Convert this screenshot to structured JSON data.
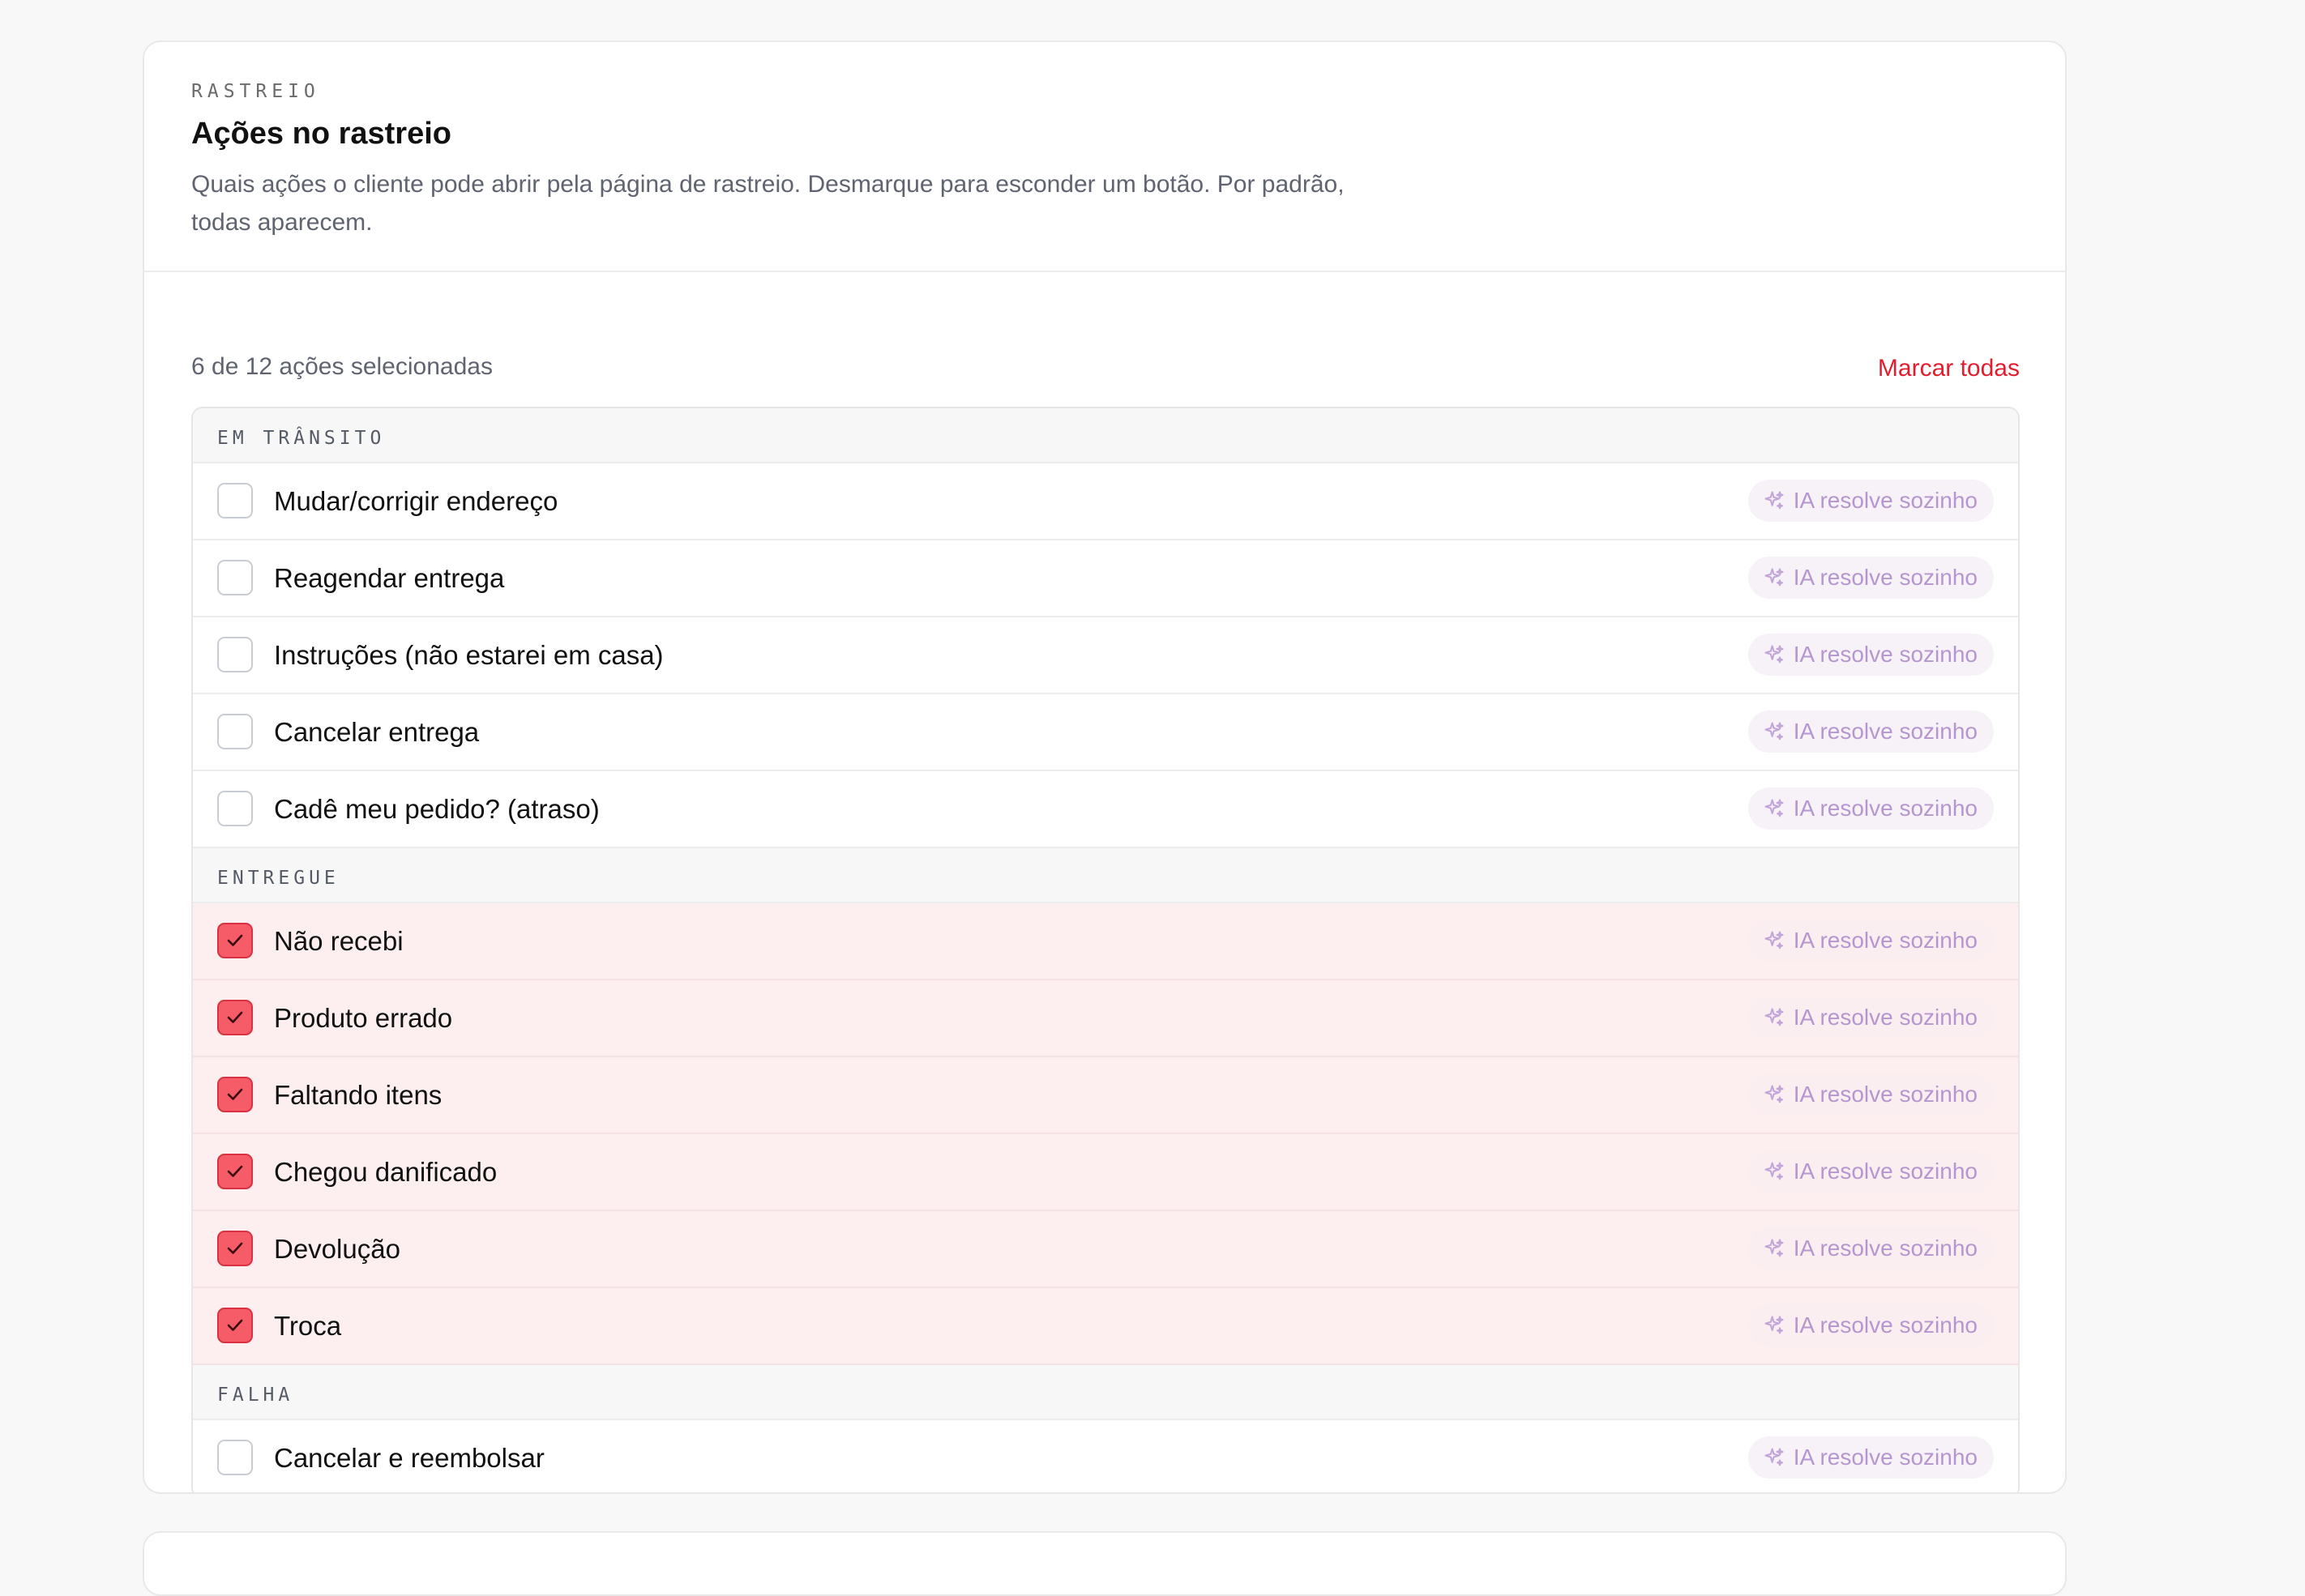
{
  "section": {
    "eyebrow": "RASTREIO",
    "title": "Ações no rastreio",
    "description": "Quais ações o cliente pode abrir pela página de rastreio. Desmarque para esconder um botão. Por padrão, todas aparecem."
  },
  "summary": {
    "count_text": "6 de 12 ações selecionadas",
    "mark_all_label": "Marcar todas"
  },
  "colors": {
    "accent": "#e11d2e",
    "checked_row_bg": "#fdeff0",
    "checkbox_checked": "#f55c68",
    "ai_badge_text": "#b596cf"
  },
  "badge_icon": "sparkles-icon",
  "groups": [
    {
      "label": "EM TRÂNSITO",
      "items": [
        {
          "label": "Mudar/corrigir endereço",
          "checked": false,
          "badge": "IA resolve sozinho"
        },
        {
          "label": "Reagendar entrega",
          "checked": false,
          "badge": "IA resolve sozinho"
        },
        {
          "label": "Instruções (não estarei em casa)",
          "checked": false,
          "badge": "IA resolve sozinho"
        },
        {
          "label": "Cancelar entrega",
          "checked": false,
          "badge": "IA resolve sozinho"
        },
        {
          "label": "Cadê meu pedido? (atraso)",
          "checked": false,
          "badge": "IA resolve sozinho"
        }
      ]
    },
    {
      "label": "ENTREGUE",
      "items": [
        {
          "label": "Não recebi",
          "checked": true,
          "badge": "IA resolve sozinho"
        },
        {
          "label": "Produto errado",
          "checked": true,
          "badge": "IA resolve sozinho"
        },
        {
          "label": "Faltando itens",
          "checked": true,
          "badge": "IA resolve sozinho"
        },
        {
          "label": "Chegou danificado",
          "checked": true,
          "badge": "IA resolve sozinho"
        },
        {
          "label": "Devolução",
          "checked": true,
          "badge": "IA resolve sozinho"
        },
        {
          "label": "Troca",
          "checked": true,
          "badge": "IA resolve sozinho"
        }
      ]
    },
    {
      "label": "FALHA",
      "items": [
        {
          "label": "Cancelar e reembolsar",
          "checked": false,
          "badge": "IA resolve sozinho"
        }
      ]
    }
  ]
}
